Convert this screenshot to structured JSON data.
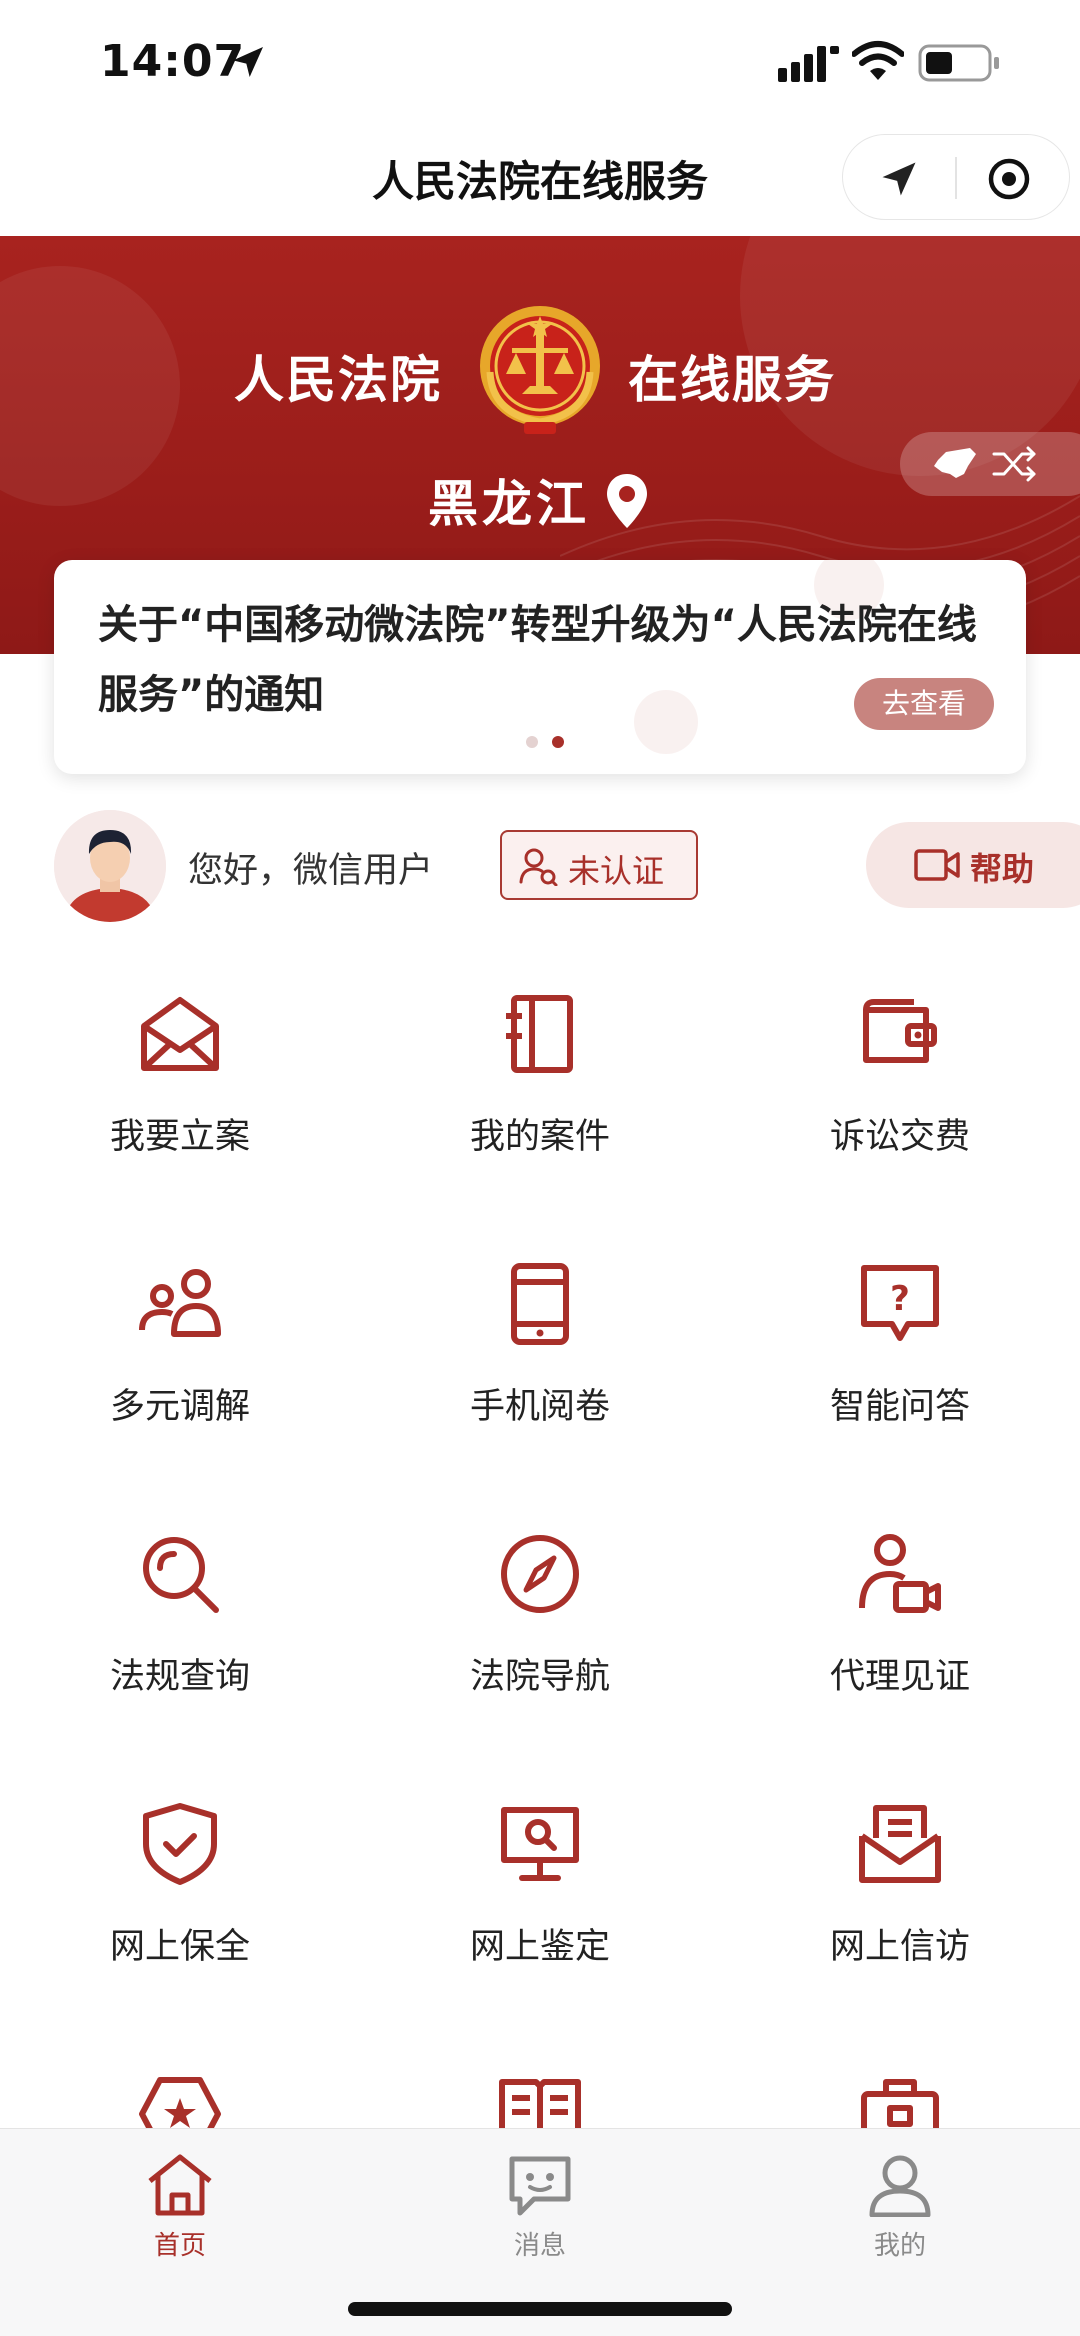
{
  "status_bar": {
    "time": "14:07"
  },
  "nav": {
    "title": "人民法院在线服务"
  },
  "banner": {
    "title_left": "人民法院",
    "title_right": "在线服务",
    "province": "黑龙江"
  },
  "notice": {
    "text": "关于“中国移动微法院”转型升级为“人民法院在线服务”的通知",
    "button": "去查看"
  },
  "user": {
    "greeting": "您好，微信用户",
    "auth_status": "未认证",
    "help_label": "帮助"
  },
  "services": [
    {
      "label": "我要立案",
      "icon": "envelope-open-icon"
    },
    {
      "label": "我的案件",
      "icon": "case-notebook-icon"
    },
    {
      "label": "诉讼交费",
      "icon": "wallet-icon"
    },
    {
      "label": "多元调解",
      "icon": "people-icon"
    },
    {
      "label": "手机阅卷",
      "icon": "mobile-phone-icon"
    },
    {
      "label": "智能问答",
      "icon": "question-bubble-icon"
    },
    {
      "label": "法规查询",
      "icon": "magnifier-icon"
    },
    {
      "label": "法院导航",
      "icon": "compass-icon"
    },
    {
      "label": "代理见证",
      "icon": "person-video-icon"
    },
    {
      "label": "网上保全",
      "icon": "shield-check-icon"
    },
    {
      "label": "网上鉴定",
      "icon": "monitor-search-icon"
    },
    {
      "label": "网上信访",
      "icon": "letter-icon"
    },
    {
      "label": "",
      "icon": "star-badge-icon"
    },
    {
      "label": "",
      "icon": "book-icon"
    },
    {
      "label": "",
      "icon": "briefcase-icon"
    }
  ],
  "tabs": [
    {
      "label": "首页",
      "icon": "home-icon",
      "active": true
    },
    {
      "label": "消息",
      "icon": "message-icon",
      "active": false
    },
    {
      "label": "我的",
      "icon": "profile-icon",
      "active": false
    }
  ],
  "colors": {
    "brand": "#a8231f",
    "icon_red": "#a8302a",
    "tab_inactive": "#8a8a8a"
  }
}
